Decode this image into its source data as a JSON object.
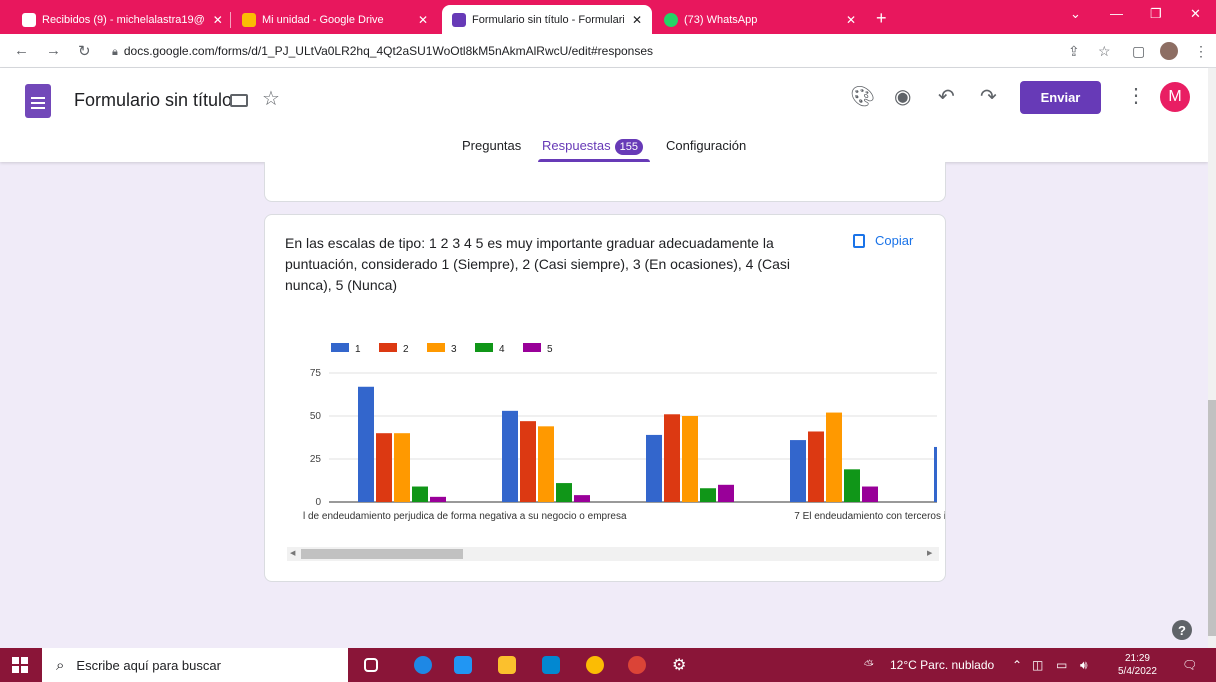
{
  "browser": {
    "tabs": [
      {
        "title": "Recibidos (9) - michelalastra19@",
        "color": "#ea4335"
      },
      {
        "title": "Mi unidad - Google Drive",
        "color": "#fbbc04"
      },
      {
        "title": "Formulario sin título - Formulario",
        "color": "#673ab7"
      },
      {
        "title": "(73) WhatsApp",
        "color": "#25d366"
      }
    ],
    "url": "docs.google.com/forms/d/1_PJ_ULtVa0LR2hq_4Qt2aSU1WoOtl8kM5nAkmAlRwcU/edit#responses"
  },
  "form": {
    "title": "Formulario sin título",
    "send_label": "Enviar",
    "avatar_letter": "M",
    "tabs": {
      "questions": "Preguntas",
      "responses": "Respuestas",
      "responses_count": "155",
      "settings": "Configuración"
    }
  },
  "card": {
    "question": "En las escalas de tipo: 1 2 3 4 5 es muy importante graduar adecuadamente la puntuación, considerado 1 (Siempre), 2 (Casi siempre), 3 (En ocasiones), 4 (Casi nunca), 5 (Nunca)",
    "copy_label": "Copiar"
  },
  "chart_data": {
    "type": "bar",
    "categories": [
      "l de endeudamiento perjudica de forma negativa a su negocio o empresa",
      "",
      "",
      "7 El endeudamiento con terceros i",
      ""
    ],
    "series": [
      {
        "name": "1",
        "color": "#3366cc",
        "values": [
          67,
          53,
          39,
          36,
          32
        ]
      },
      {
        "name": "2",
        "color": "#dc3912",
        "values": [
          40,
          47,
          51,
          41,
          null
        ]
      },
      {
        "name": "3",
        "color": "#ff9900",
        "values": [
          40,
          44,
          50,
          52,
          null
        ]
      },
      {
        "name": "4",
        "color": "#109618",
        "values": [
          9,
          11,
          8,
          19,
          null
        ]
      },
      {
        "name": "5",
        "color": "#990099",
        "values": [
          3,
          4,
          10,
          9,
          null
        ]
      }
    ],
    "yticks": [
      "0",
      "25",
      "50",
      "75"
    ],
    "ylim": [
      0,
      75
    ],
    "grid": true,
    "legend": "top-left"
  },
  "taskbar": {
    "search_placeholder": "Escribe aquí para buscar",
    "weather": "12°C  Parc. nublado",
    "time": "21:29",
    "date": "5/4/2022"
  }
}
